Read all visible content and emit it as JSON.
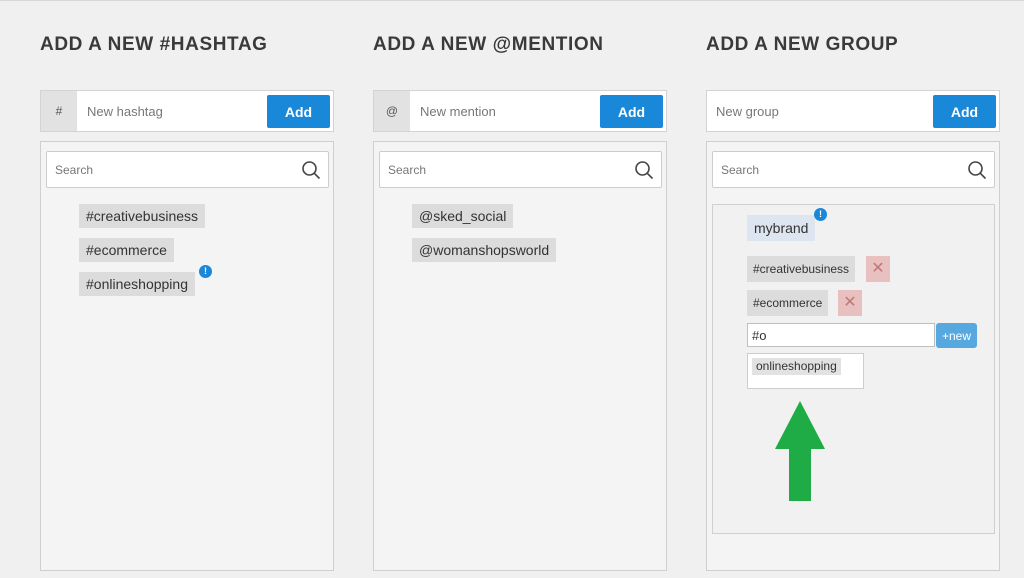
{
  "hashtag": {
    "title": "ADD A NEW #HASHTAG",
    "prefix": "#",
    "placeholder": "New hashtag",
    "add_label": "Add",
    "search_placeholder": "Search",
    "items": [
      "#creativebusiness",
      "#ecommerce",
      "#onlineshopping"
    ]
  },
  "mention": {
    "title": "ADD A NEW @MENTION",
    "prefix": "@",
    "placeholder": "New mention",
    "add_label": "Add",
    "search_placeholder": "Search",
    "items": [
      "@sked_social",
      "@womanshopsworld"
    ]
  },
  "group": {
    "title": "ADD A NEW GROUP",
    "placeholder": "New group",
    "add_label": "Add",
    "search_placeholder": "Search",
    "name": "mybrand",
    "tags": [
      "#creativebusiness",
      "#ecommerce"
    ],
    "remove_glyph": "✕",
    "tag_input_value": "#o",
    "new_label": "+new",
    "suggestion": "onlineshopping"
  },
  "info_glyph": "!",
  "colors": {
    "accent": "#1a88d8",
    "arrow": "#1fab45",
    "remove_bg": "#e8c0c0"
  }
}
